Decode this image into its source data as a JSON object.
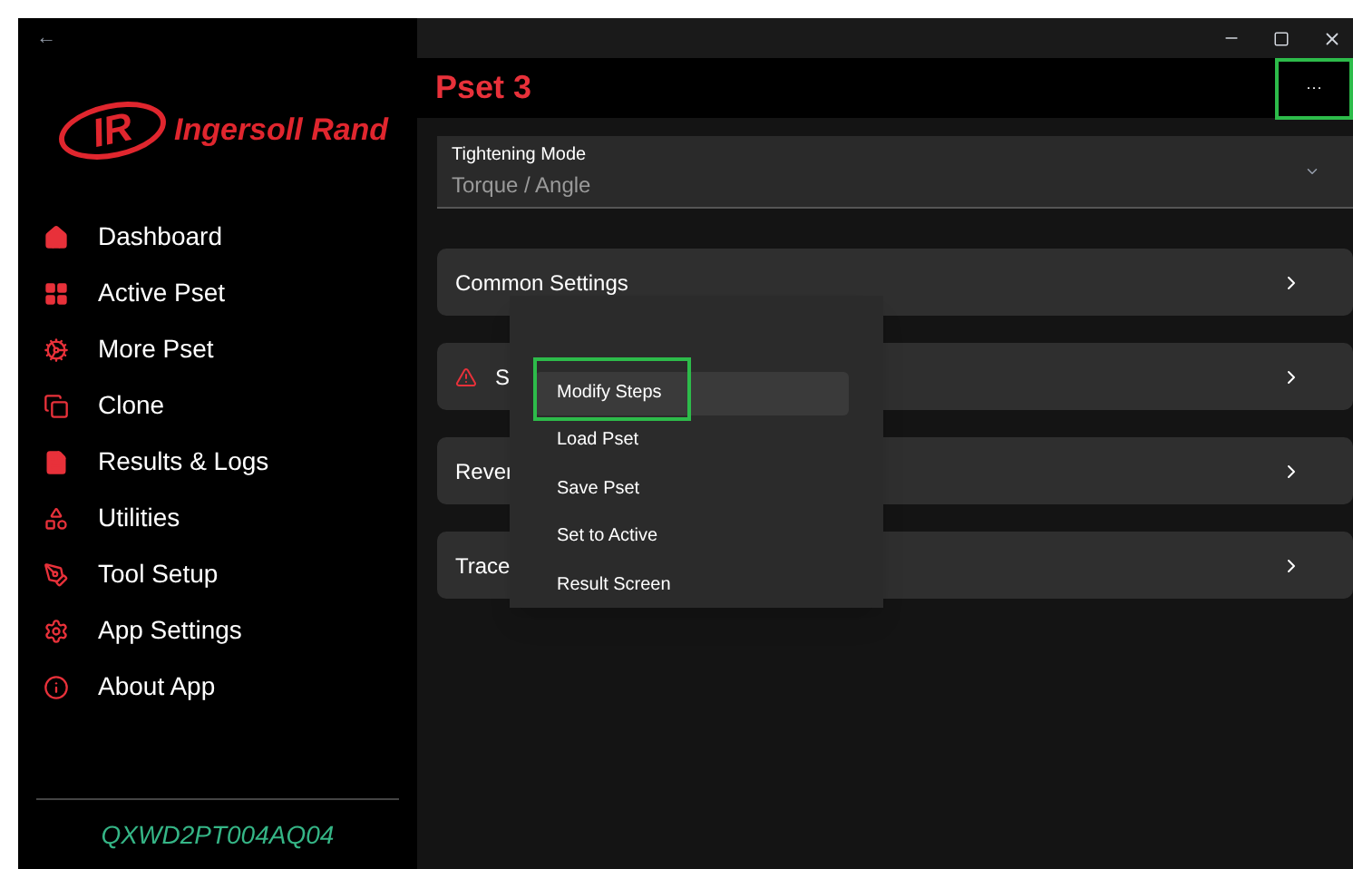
{
  "window": {
    "back": "←"
  },
  "sidebar": {
    "logo_mark": "IR",
    "logo_text": "Ingersoll Rand",
    "items": [
      {
        "label": "Dashboard"
      },
      {
        "label": "Active Pset"
      },
      {
        "label": "More Pset"
      },
      {
        "label": "Clone"
      },
      {
        "label": "Results & Logs"
      },
      {
        "label": "Utilities"
      },
      {
        "label": "Tool Setup"
      },
      {
        "label": "App Settings"
      },
      {
        "label": "About App"
      }
    ],
    "serial": "QXWD2PT004AQ04"
  },
  "header": {
    "title": "Pset 3",
    "more": "···",
    "more_annotated": true
  },
  "tightening_mode": {
    "label": "Tightening Mode",
    "value": "Torque / Angle"
  },
  "sections": [
    {
      "label": "Common Settings",
      "warning": false
    },
    {
      "label": "S",
      "warning": true
    },
    {
      "label": "Rever",
      "warning": false
    },
    {
      "label": "Trace",
      "warning": false
    }
  ],
  "menu": [
    {
      "label": "Modify Steps",
      "selected": true,
      "annotated": true
    },
    {
      "label": "Load Pset",
      "selected": false,
      "annotated": false
    },
    {
      "label": "Save Pset",
      "selected": false,
      "annotated": false
    },
    {
      "label": "Set to Active",
      "selected": false,
      "annotated": false
    },
    {
      "label": "Result Screen",
      "selected": false,
      "annotated": false
    }
  ]
}
